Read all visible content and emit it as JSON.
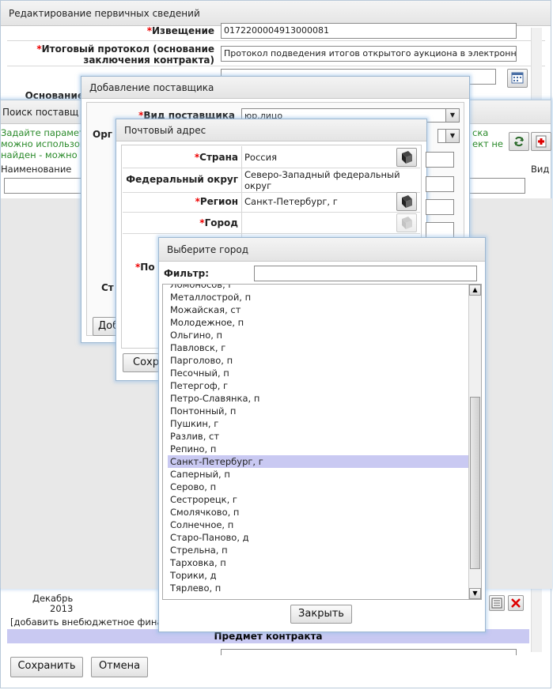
{
  "main": {
    "title": "Редактирование первичных сведений",
    "notice_label": "Извещение",
    "notice_value": "0172200004913000081",
    "protocol_label_1": "Итоговый протокол (основание",
    "protocol_label_2": "заключения контракта)",
    "protocol_value": "Протокол подведения итогов открытого аукциона в электронн",
    "basis_label": "Основание",
    "month": "Декабрь",
    "year": "2013",
    "add_offbudget": "[добавить внебюджетное фина",
    "contract_subject": "Предмет контракта",
    "save_button": "Сохранить",
    "cancel_button": "Отмена"
  },
  "search": {
    "title": "Поиск поставщ",
    "hint_1": "Задайте парамет",
    "hint_2": "можно использов",
    "hint_3": "найден - можно",
    "hint_r1": "ска",
    "hint_r2": "ект не",
    "col_name": "Наименование",
    "col_type": "Вид"
  },
  "add_supplier": {
    "title": "Добавление поставщика",
    "type_label": "Вид поставщика",
    "type_value": "юр.лицо",
    "org_label": "Орг",
    "st_label": "Ст",
    "add_button": "Доб"
  },
  "postal": {
    "title": "Почтовый адрес",
    "country_label": "Страна",
    "country_value": "Россия",
    "district_label": "Федеральный округ",
    "district_value": "Северо-Западный федеральный округ",
    "region_label": "Регион",
    "region_value": "Санкт-Петербург, г",
    "city_label": "Город",
    "po_label": "По",
    "save_button": "Сохр"
  },
  "city_dialog": {
    "title": "Выберите город",
    "filter_label": "Фильтр:",
    "filter_value": "",
    "cities": [
      "Ломоносов, г",
      "Металлострой, п",
      "Можайская, ст",
      "Молодежное, п",
      "Ольгино, п",
      "Павловск, г",
      "Парголово, п",
      "Песочный, п",
      "Петергоф, г",
      "Петро-Славянка, п",
      "Понтонный, п",
      "Пушкин, г",
      "Разлив, ст",
      "Репино, п",
      "Санкт-Петербург, г",
      "Саперный, п",
      "Серово, п",
      "Сестрорецк, г",
      "Смолячково, п",
      "Солнечное, п",
      "Старо-Паново, д",
      "Стрельна, п",
      "Тарховка, п",
      "Торики, д",
      "Тярлево, п"
    ],
    "selected": "Санкт-Петербург, г",
    "close_button": "Закрыть"
  },
  "colors": {
    "accent": "#c9c9f2",
    "required": "#e00000",
    "hint": "#2a8a2a",
    "border": "#9db7d0"
  }
}
